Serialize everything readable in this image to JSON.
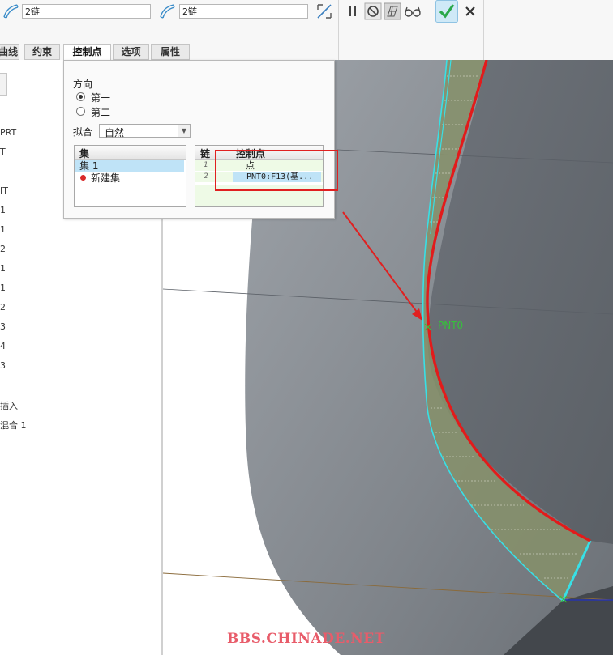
{
  "toolbar": {
    "chain1_value": "2链",
    "chain2_value": "2链",
    "icons": [
      "surface-chain-icon",
      "surface-chain-icon",
      "flip-direction-icon",
      "pause-icon",
      "no-preview-icon",
      "mesh-preview-icon",
      "glasses-preview-icon",
      "confirm-check-icon",
      "cancel-x-icon"
    ],
    "confirm_color": "#2aa84a"
  },
  "tabs": [
    {
      "label": "曲线"
    },
    {
      "label": "约束"
    },
    {
      "label": "控制点"
    },
    {
      "label": "选项"
    },
    {
      "label": "属性"
    }
  ],
  "panel": {
    "direction_label": "方向",
    "option_first": "第一",
    "option_second": "第二",
    "fit_label": "拟合",
    "fit_value": "自然",
    "set_header": "集",
    "set_item": "集 1",
    "new_set": "新建集",
    "cp_col_chain": "链",
    "cp_col_point": "控制点",
    "rows": [
      {
        "num": "1",
        "value": "点"
      },
      {
        "num": "2",
        "value": "PNT0:F13(基..."
      }
    ]
  },
  "tree": {
    "items": [
      "PRT",
      "T",
      "IT",
      "1",
      "1",
      "2",
      "1",
      "1",
      "2",
      "3",
      "4",
      "3",
      "插入",
      "混合 1"
    ]
  },
  "viewport": {
    "point_label": "PNT0"
  },
  "watermark": "BBS.CHINADE.NET"
}
